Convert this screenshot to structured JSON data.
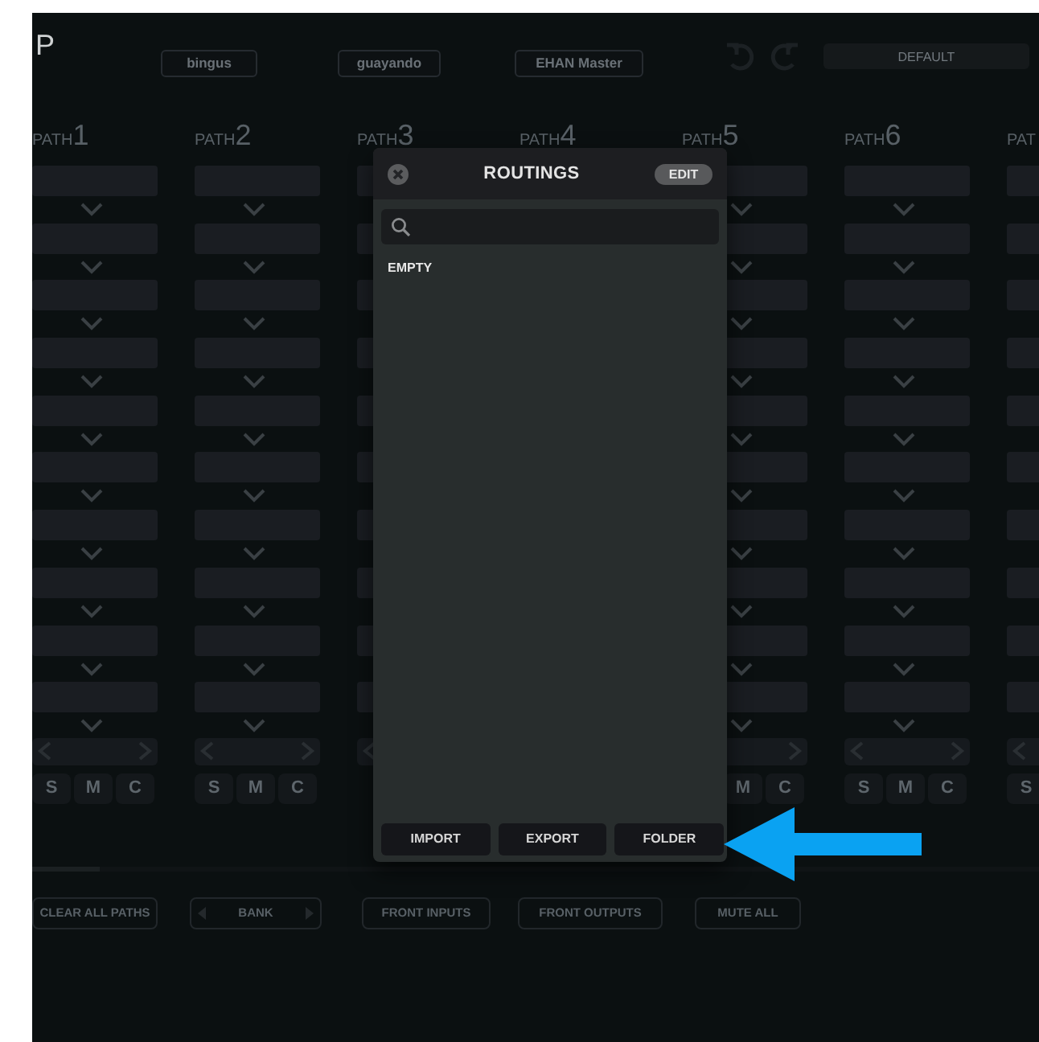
{
  "app": {
    "title_fragment": "P",
    "presets": [
      {
        "label": "bingus"
      },
      {
        "label": "guayando"
      },
      {
        "label": "EHAN Master"
      }
    ],
    "default_field": {
      "value": "DEFAULT"
    }
  },
  "paths": [
    {
      "label": "PATH",
      "number": "1",
      "buttons": [
        {
          "kind": "solo",
          "label": "S"
        },
        {
          "kind": "mute",
          "label": "M"
        },
        {
          "kind": "cue",
          "label": "C"
        }
      ]
    },
    {
      "label": "PATH",
      "number": "2",
      "buttons": [
        {
          "kind": "solo",
          "label": "S"
        },
        {
          "kind": "mute",
          "label": "M"
        },
        {
          "kind": "cue",
          "label": "C"
        }
      ]
    },
    {
      "label": "PATH",
      "number": "3"
    },
    {
      "label": "PATH",
      "number": "4"
    },
    {
      "label": "PATH",
      "number": "5",
      "buttons": [
        {
          "kind": "mute",
          "label": "M"
        },
        {
          "kind": "cue",
          "label": "C"
        }
      ]
    },
    {
      "label": "PATH",
      "number": "6",
      "buttons": [
        {
          "kind": "solo",
          "label": "S"
        },
        {
          "kind": "mute",
          "label": "M"
        },
        {
          "kind": "cue",
          "label": "C"
        }
      ]
    },
    {
      "label": "PAT",
      "buttons": [
        {
          "kind": "solo",
          "label": "S"
        }
      ]
    }
  ],
  "bottom_buttons": [
    {
      "kind": "plain",
      "label": "CLEAR ALL PATHS"
    },
    {
      "kind": "stepper",
      "label": "BANK"
    },
    {
      "kind": "plain",
      "label": "FRONT INPUTS"
    },
    {
      "kind": "plain",
      "label": "FRONT OUTPUTS"
    },
    {
      "kind": "plain",
      "label": "MUTE ALL"
    }
  ],
  "dialog": {
    "title": "ROUTINGS",
    "edit_button": "EDIT",
    "items": [
      "EMPTY"
    ],
    "buttons": [
      "IMPORT",
      "EXPORT",
      "FOLDER"
    ]
  }
}
